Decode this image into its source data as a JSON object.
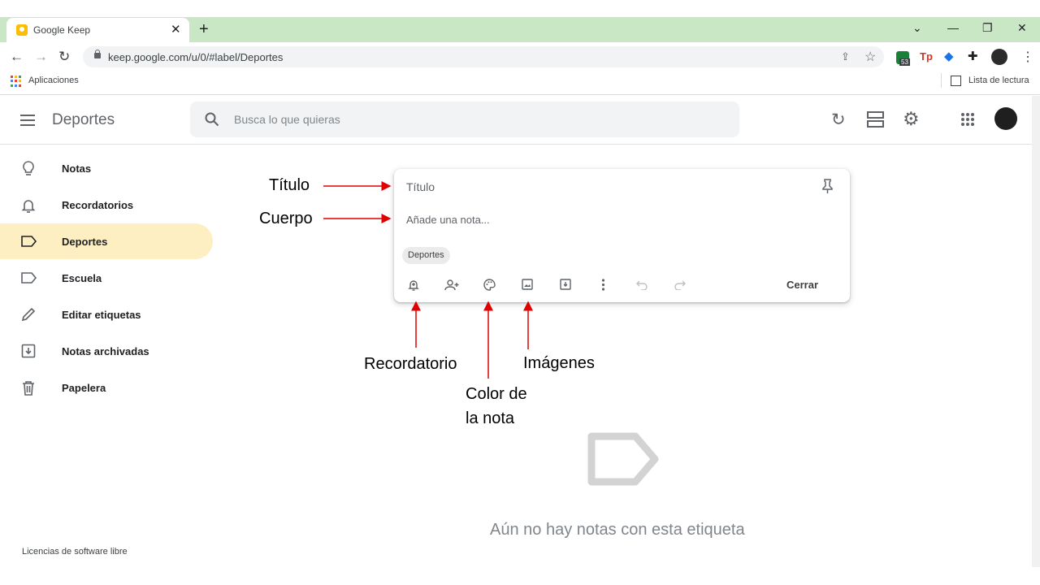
{
  "browser": {
    "tab_title": "Google Keep",
    "url": "keep.google.com/u/0/#label/Deportes",
    "bookmark_apps": "Aplicaciones",
    "reading_list": "Lista de lectura",
    "ext_badge": "53",
    "ext_tp": "Tp"
  },
  "header": {
    "title": "Deportes",
    "search_placeholder": "Busca lo que quieras"
  },
  "sidebar": {
    "items": [
      {
        "label": "Notas",
        "icon": "lightbulb-icon"
      },
      {
        "label": "Recordatorios",
        "icon": "bell-icon"
      },
      {
        "label": "Deportes",
        "icon": "label-icon",
        "active": true
      },
      {
        "label": "Escuela",
        "icon": "label-icon"
      },
      {
        "label": "Editar etiquetas",
        "icon": "pencil-icon"
      },
      {
        "label": "Notas archivadas",
        "icon": "archive-icon"
      },
      {
        "label": "Papelera",
        "icon": "trash-icon"
      }
    ],
    "footer": "Licencias de software libre"
  },
  "note": {
    "title_placeholder": "Título",
    "body_placeholder": "Añade una nota...",
    "label_chip": "Deportes",
    "close_label": "Cerrar"
  },
  "annotations": {
    "titulo": "Título",
    "cuerpo": "Cuerpo",
    "recordatorio": "Recordatorio",
    "color_line1": "Color de",
    "color_line2": "la nota",
    "imagenes": "Imágenes"
  },
  "empty_state": {
    "text": "Aún no hay notas con esta etiqueta"
  },
  "colors": {
    "tabbar": "#c9e7c5",
    "active_item": "#feefc3",
    "arrow": "#e00000"
  }
}
